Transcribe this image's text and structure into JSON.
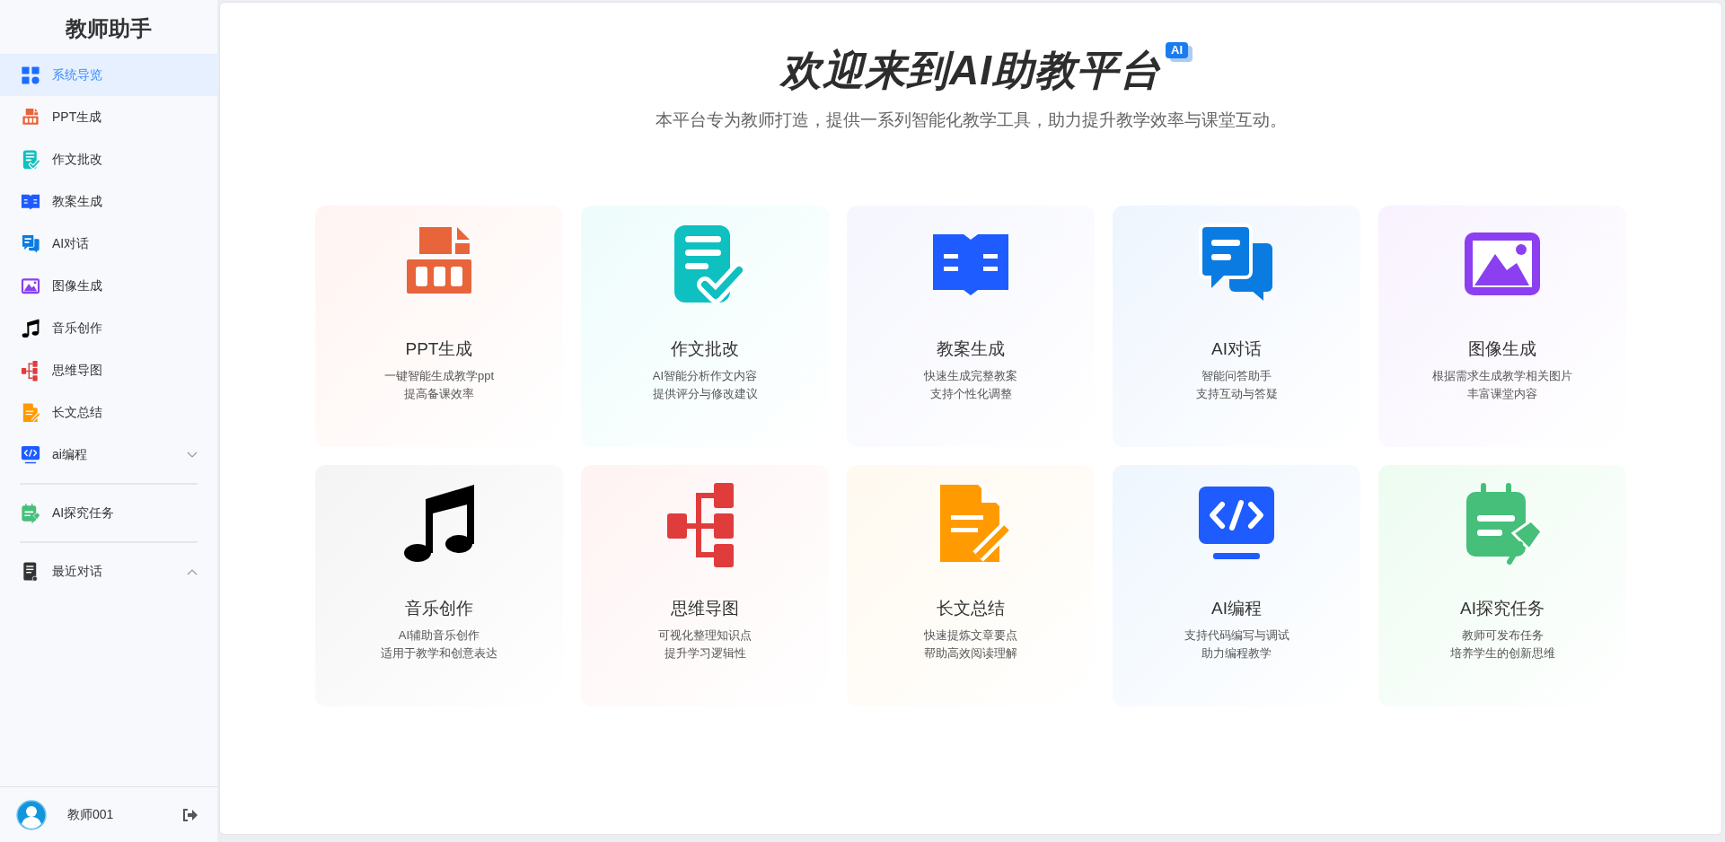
{
  "sidebar": {
    "title": "教师助手",
    "sections": [
      {
        "items": [
          {
            "label": "系统导览",
            "kind": "link",
            "selected": true
          },
          {
            "label": "PPT生成",
            "kind": "link",
            "selected": false
          },
          {
            "label": "作文批改",
            "kind": "link",
            "selected": false
          },
          {
            "label": "教案生成",
            "kind": "link",
            "selected": false
          },
          {
            "label": "AI对话",
            "kind": "link",
            "selected": false
          },
          {
            "label": "图像生成",
            "kind": "link",
            "selected": false
          },
          {
            "label": "音乐创作",
            "kind": "link",
            "selected": false
          },
          {
            "label": "思维导图",
            "kind": "link",
            "selected": false
          },
          {
            "label": "长文总结",
            "kind": "link",
            "selected": false
          },
          {
            "label": "ai编程",
            "kind": "group",
            "selected": false,
            "expanded": false
          }
        ]
      },
      {
        "items": [
          {
            "label": "AI探究任务",
            "kind": "link",
            "selected": false
          }
        ]
      },
      {
        "items": [
          {
            "label": "最近对话",
            "kind": "group",
            "selected": false,
            "expanded": true
          }
        ]
      }
    ]
  },
  "user": {
    "name": "教师001"
  },
  "main": {
    "title": "欢迎来到AI助教平台",
    "title_badge": "AI",
    "subtitle": "本平台专为教师打造，提供一系列智能化教学工具，助力提升教学效率与课堂互动。",
    "cards": [
      {
        "title": "PPT生成",
        "lines": [
          "一键智能生成教学ppt",
          "提高备课效率"
        ]
      },
      {
        "title": "作文批改",
        "lines": [
          "AI智能分析作文内容",
          "提供评分与修改建议"
        ]
      },
      {
        "title": "教案生成",
        "lines": [
          "快速生成完整教案",
          "支持个性化调整"
        ]
      },
      {
        "title": "AI对话",
        "lines": [
          "智能问答助手",
          "支持互动与答疑"
        ]
      },
      {
        "title": "图像生成",
        "lines": [
          "根据需求生成教学相关图片",
          "丰富课堂内容"
        ]
      },
      {
        "title": "音乐创作",
        "lines": [
          "AI辅助音乐创作",
          "适用于教学和创意表达"
        ]
      },
      {
        "title": "思维导图",
        "lines": [
          "可视化整理知识点",
          "提升学习逻辑性"
        ]
      },
      {
        "title": "长文总结",
        "lines": [
          "快速提炼文章要点",
          "帮助高效阅读理解"
        ]
      },
      {
        "title": "AI编程",
        "lines": [
          "支持代码编写与调试",
          "助力编程教学"
        ]
      },
      {
        "title": "AI探究任务",
        "lines": [
          "教师可发布任务",
          "培养学生的创新思维"
        ]
      }
    ]
  }
}
